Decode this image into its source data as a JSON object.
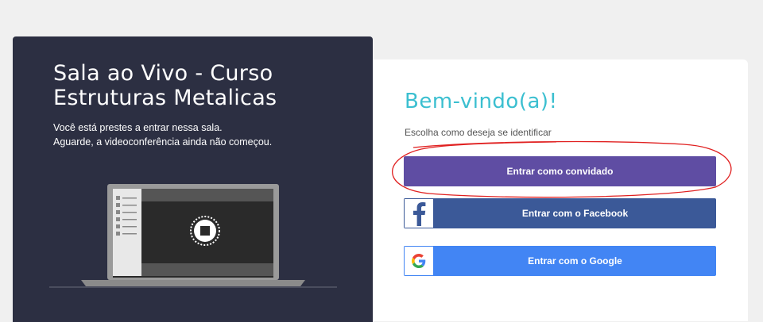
{
  "room": {
    "title": "Sala ao Vivo - Curso Estruturas Metalicas",
    "desc_line1": "Você está prestes a entrar nessa sala.",
    "desc_line2": "Aguarde, a videoconferência ainda não começou."
  },
  "login": {
    "welcome": "Bem-vindo(a)!",
    "subtitle": "Escolha como deseja se identificar",
    "guest_label": "Entrar como convidado",
    "facebook_label": "Entrar com o Facebook",
    "google_label": "Entrar com o Google"
  },
  "icons": {
    "facebook": "facebook-icon",
    "google": "google-icon",
    "laptop": "laptop-illustration"
  },
  "colors": {
    "dark_panel": "#2c2f42",
    "accent_cyan": "#3bbfd0",
    "guest_button": "#5f4da3",
    "facebook_button": "#3b5998",
    "google_button": "#4285f4",
    "annotation_circle": "#e02020"
  }
}
